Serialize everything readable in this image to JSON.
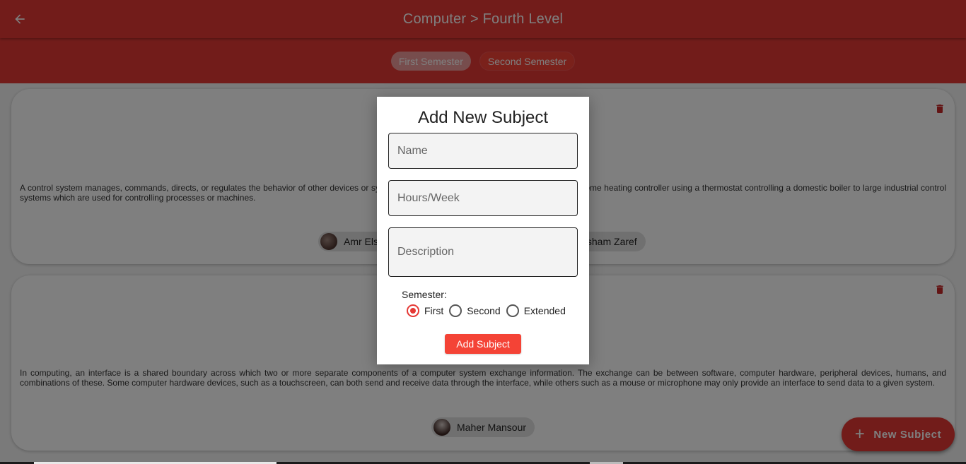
{
  "appbar": {
    "title": "Computer > Fourth Level",
    "back_icon": "arrow-left-icon"
  },
  "tabs": [
    {
      "label": "First Semester",
      "selected": true
    },
    {
      "label": "Second Semester",
      "selected": false
    }
  ],
  "subjects": [
    {
      "description": "A control system manages, commands, directs, or regulates the behavior of other devices or systems using control loops. It can range from a single home heating controller using a thermostat controlling a domestic boiler to large industrial control systems which are used for controlling processes or machines.",
      "teachers": [
        "Amr Elsayed",
        "Hesham Zaref"
      ]
    },
    {
      "description": "In computing, an interface is a shared boundary across which two or more separate components of a computer system exchange information. The exchange can be between software, computer hardware, peripheral devices, humans, and combinations of these. Some computer hardware devices, such as a touchscreen, can both send and receive data through the interface, while others such as a mouse or microphone may only provide an interface to send data to a given system.",
      "teachers": [
        "Maher Mansour"
      ]
    }
  ],
  "fab": {
    "label": "New Subject",
    "icon": "plus-icon"
  },
  "dialog": {
    "title": "Add New Subject",
    "name_placeholder": "Name",
    "hours_placeholder": "Hours/Week",
    "description_placeholder": "Description",
    "semester_label": "Semester:",
    "semester_options": [
      "First",
      "Second",
      "Extended"
    ],
    "semester_selected": "First",
    "submit_label": "Add Subject"
  },
  "colors": {
    "primary": "#e53935",
    "accent": "#f44336",
    "chip_selected": "#ef9a9a",
    "trash": "#c62828"
  }
}
